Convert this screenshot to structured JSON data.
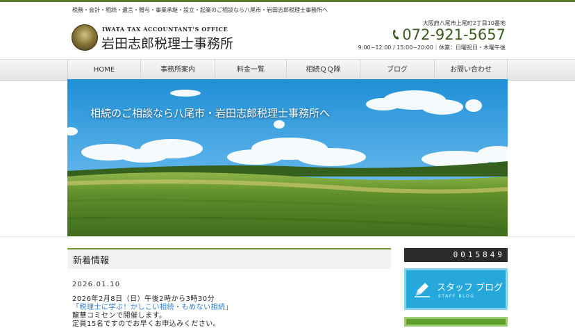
{
  "header": {
    "tagline": "税務・会計・相続・遺言・贈与・事業承継・設立・起業のご相談なら八尾市・岩田志郎税理士事務所へ",
    "logo_en": "IWATA TAX ACCOUNTANT'S OFFICE",
    "logo_jp": "岩田志郎税理士事務所",
    "address": "大阪府八尾市上尾町2丁目10番地",
    "phone": "072-921-5657",
    "hours": "9:00~12:00 / 15:00~20:00｜休業：日曜祝日・木曜午後"
  },
  "nav": {
    "items": [
      {
        "label": "HOME"
      },
      {
        "label": "事務所案内"
      },
      {
        "label": "料金一覧"
      },
      {
        "label": "相続ＱＱ隊"
      },
      {
        "label": "ブログ"
      },
      {
        "label": "お問い合わせ"
      }
    ]
  },
  "hero": {
    "caption": "相続のご相談なら八尾市・岩田志郎税理士事務所へ"
  },
  "news": {
    "heading": "新着情報",
    "date": "2026.01.10",
    "line1": "2026年2月8日（日）午後2時から3時30分",
    "link": "「税理士に学ぶ！かしこい相続・もめない相続」",
    "line3": "龍華コミセンで開催します。",
    "line4": "定員15名ですのでお早くお申込みください。"
  },
  "sidebar": {
    "counter": "0015849",
    "staff_blog_jp": "スタッフ ブログ",
    "staff_blog_en": "STAFF BLOG"
  },
  "colors": {
    "accent_green": "#5a7a2c",
    "link_blue": "#2b7bd3",
    "banner_blue": "#26a8dc"
  }
}
